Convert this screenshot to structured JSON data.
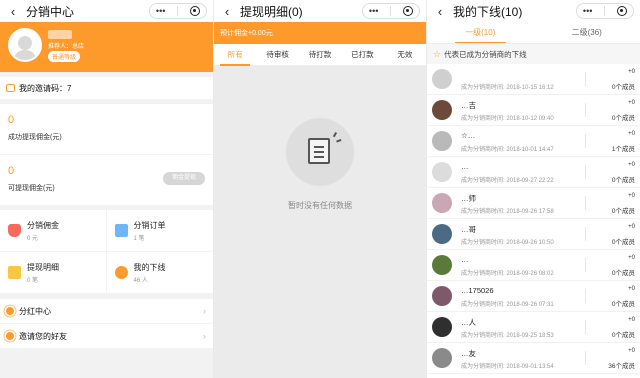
{
  "panel1": {
    "title": "分销中心",
    "back": "‹",
    "capsule": {
      "more": "•••"
    },
    "profile": {
      "referrer": "推荐人：总店",
      "badge": "普通等级"
    },
    "invite_label": "我的邀请码：",
    "invite_code": "7",
    "commission": {
      "value": "0",
      "label": "成功提现佣金(元)"
    },
    "withdrawable": {
      "value": "0",
      "label": "可提现佣金(元)",
      "button": "佣金提现"
    },
    "grid": [
      {
        "title": "分销佣金",
        "sub": "0 元",
        "icon": "moneybag-icon"
      },
      {
        "title": "分销订单",
        "sub": "1 笔",
        "icon": "clipboard-icon"
      },
      {
        "title": "提现明细",
        "sub": "0 笔",
        "icon": "wallet-icon"
      },
      {
        "title": "我的下线",
        "sub": "46 人",
        "icon": "person-icon"
      }
    ],
    "menu": [
      {
        "label": "分红中心"
      },
      {
        "label": "邀请您的好友"
      }
    ]
  },
  "panel2": {
    "title": "提现明细(0)",
    "back": "‹",
    "capsule": {
      "more": "•••"
    },
    "expected": "预计佣金+0.00元",
    "tabs": [
      "所有",
      "待审核",
      "待打款",
      "已打款",
      "无效"
    ],
    "empty_text": "暂时没有任何数据"
  },
  "panel3": {
    "title": "我的下线(10)",
    "back": "‹",
    "capsule": {
      "more": "•••"
    },
    "level_tabs": [
      "一级(10)",
      "二级(36)"
    ],
    "notice": "代表已成为分销商的下线",
    "members": [
      {
        "name": "",
        "time": "成为分销商时间: 2018-10-15 16:12",
        "plus": "+0",
        "count": "0个成员",
        "color": "#cfcfcf"
      },
      {
        "name": "…吉",
        "time": "成为分销商时间: 2018-10-12 09:40",
        "plus": "+0",
        "count": "0个成员",
        "color": "#6b4a3a"
      },
      {
        "name": "☆…",
        "time": "成为分销商时间: 2018-10-01 14:47",
        "plus": "+0",
        "count": "1个成员",
        "color": "#b9b9b9"
      },
      {
        "name": "…",
        "time": "成为分销商时间: 2018-09-27 22:22",
        "plus": "+0",
        "count": "0个成员",
        "color": "#dcdcdc"
      },
      {
        "name": "…师",
        "time": "成为分销商时间: 2018-09-26 17:58",
        "plus": "+0",
        "count": "0个成员",
        "color": "#c9a7b5"
      },
      {
        "name": "…哥",
        "time": "成为分销商时间: 2018-09-26 10:50",
        "plus": "+0",
        "count": "0个成员",
        "color": "#4b6a86"
      },
      {
        "name": "…",
        "time": "成为分销商时间: 2018-09-26 08:02",
        "plus": "+0",
        "count": "0个成员",
        "color": "#5a7a3a"
      },
      {
        "name": "…175026",
        "time": "成为分销商时间: 2018-09-26 07:31",
        "plus": "+0",
        "count": "0个成员",
        "color": "#7c5a6a"
      },
      {
        "name": "…人",
        "time": "成为分销商时间: 2018-09-25 18:53",
        "plus": "+0",
        "count": "0个成员",
        "color": "#2f2f2f"
      },
      {
        "name": "…友",
        "time": "成为分销商时间: 2018-09-01 13:54",
        "plus": "+0",
        "count": "36个成员",
        "color": "#8a8a8a"
      }
    ]
  },
  "colors": {
    "accent": "#fe9a2c",
    "bg": "#f2f2f2"
  }
}
